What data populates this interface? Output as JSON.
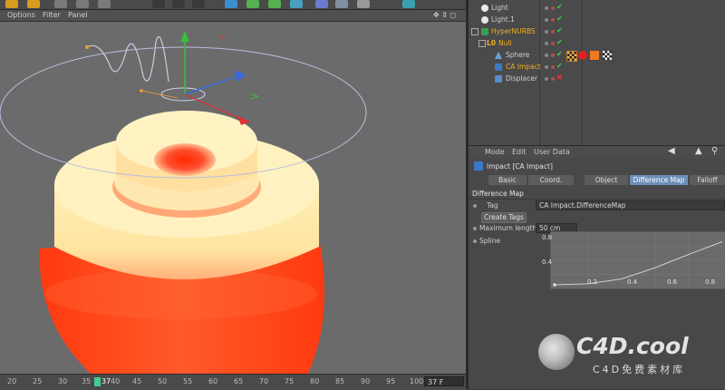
{
  "viewport": {
    "menu": [
      "Options",
      "Filter",
      "Panel"
    ]
  },
  "timeline": {
    "ticks": [
      "20",
      "25",
      "30",
      "35",
      "37",
      "40",
      "45",
      "50",
      "55",
      "60",
      "65",
      "70",
      "75",
      "80",
      "85",
      "90",
      "95",
      "100"
    ],
    "frame_value": "37 F"
  },
  "object_manager": {
    "objects": [
      {
        "name": "Light",
        "icon": "light-icon"
      },
      {
        "name": "Light.1",
        "icon": "light-icon"
      },
      {
        "name": "HyperNURBS",
        "icon": "hypernurbs-icon"
      },
      {
        "name": "Null",
        "icon": "null-icon"
      },
      {
        "name": "Sphere",
        "icon": "sphere-icon"
      },
      {
        "name": "CA Impact",
        "icon": "impact-icon"
      },
      {
        "name": "Displacer",
        "icon": "displacer-icon"
      }
    ]
  },
  "attribute_manager": {
    "menu": [
      "Mode",
      "Edit",
      "User Data"
    ],
    "title": "Impact [CA Impact]",
    "tabs": [
      "Basic",
      "Coord.",
      "Object",
      "Difference Map",
      "Falloff"
    ],
    "active_tab": "Difference Map",
    "section": "Difference Map",
    "tag_label": "Tag",
    "tag_value": "CA Impact.DifferenceMap",
    "create_tags": "Create Tags",
    "max_length_label": "Maximum length",
    "max_length_value": "50 cm",
    "spline_label": "Spline",
    "graph": {
      "y_labels": [
        "0.8",
        "0.4"
      ],
      "x_labels": [
        "0.2",
        "0.4",
        "0.6",
        "0.8"
      ],
      "curve": [
        [
          0,
          0
        ],
        [
          0.2,
          0.02
        ],
        [
          0.4,
          0.12
        ],
        [
          0.6,
          0.35
        ],
        [
          0.8,
          0.62
        ],
        [
          1,
          0.88
        ]
      ]
    }
  },
  "watermark": {
    "title": "C4D.cool",
    "subtitle": "C4D免费素材库"
  },
  "colors": {
    "accent_tab": "#6c8fb8",
    "check": "#3fd13f",
    "cross": "#e03030",
    "object_orange": "#f0b020"
  }
}
